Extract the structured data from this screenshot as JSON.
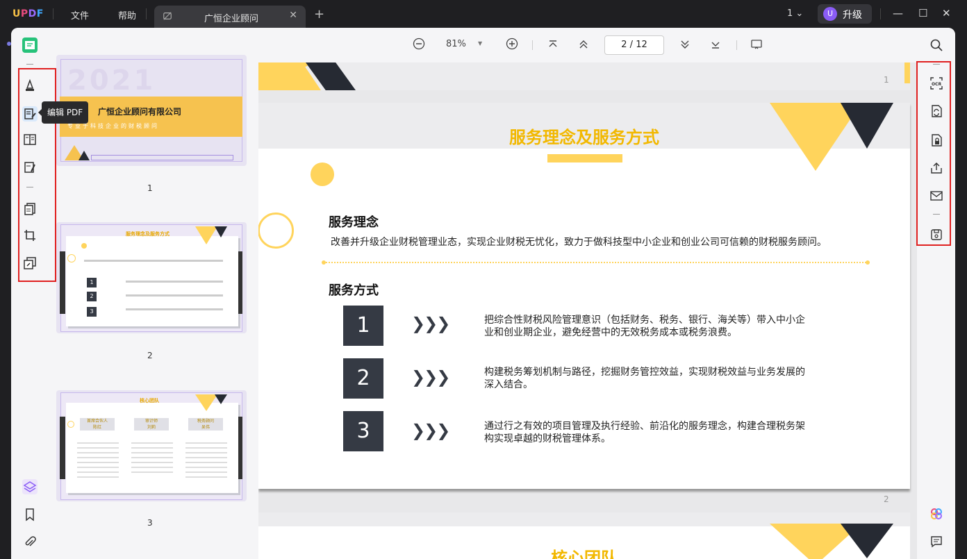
{
  "app": {
    "logo": "UPDF",
    "menu": [
      "文件",
      "帮助"
    ],
    "tab_title": "广恒企业顾问",
    "page_selector": "1",
    "upgrade_avatar": "U",
    "upgrade_label": "升级"
  },
  "tooltip": "编辑 PDF",
  "toolbar": {
    "zoom": "81%",
    "current_page": "2",
    "page_sep": "/",
    "total_pages": "12"
  },
  "thumbnails": [
    {
      "number": "1",
      "year": "2021",
      "title": "广恒企业顾问有限公司",
      "subtitle": "专业于科技企业的财税顾问"
    },
    {
      "number": "2",
      "title": "服务理念及服务方式"
    },
    {
      "number": "3",
      "title": "核心团队",
      "cards": [
        "首席合伙人\n陈红",
        "审计师\n刘莉",
        "税务顾问\n吴伟"
      ]
    }
  ],
  "document": {
    "page1_number": "1",
    "page2_number": "2",
    "heading": "服务理念及服务方式",
    "concept_title": "服务理念",
    "concept_text": "改善并升级企业财税管理业态，实现企业财税无忧化，致力于做科技型中小企业和创业公司可信赖的财税服务顾问。",
    "method_title": "服务方式",
    "methods": [
      {
        "num": "1",
        "text": "把综合性财税风险管理意识（包括财务、税务、银行、海关等）带入中小企业和创业期企业，避免经营中的无效税务成本或税务浪费。"
      },
      {
        "num": "2",
        "text": "构建税务筹划机制与路径，挖掘财务管控效益，实现财税效益与业务发展的深入结合。"
      },
      {
        "num": "3",
        "text": "通过行之有效的项目管理及执行经验、前沿化的服务理念，构建合理税务架构实现卓越的财税管理体系。"
      }
    ],
    "next_heading_partial": "核心团队"
  },
  "colors": {
    "accent_yellow": "#ffd45c",
    "dark_navy": "#262a33",
    "highlight_red": "#e02020",
    "heading_gold": "#f2b800"
  }
}
